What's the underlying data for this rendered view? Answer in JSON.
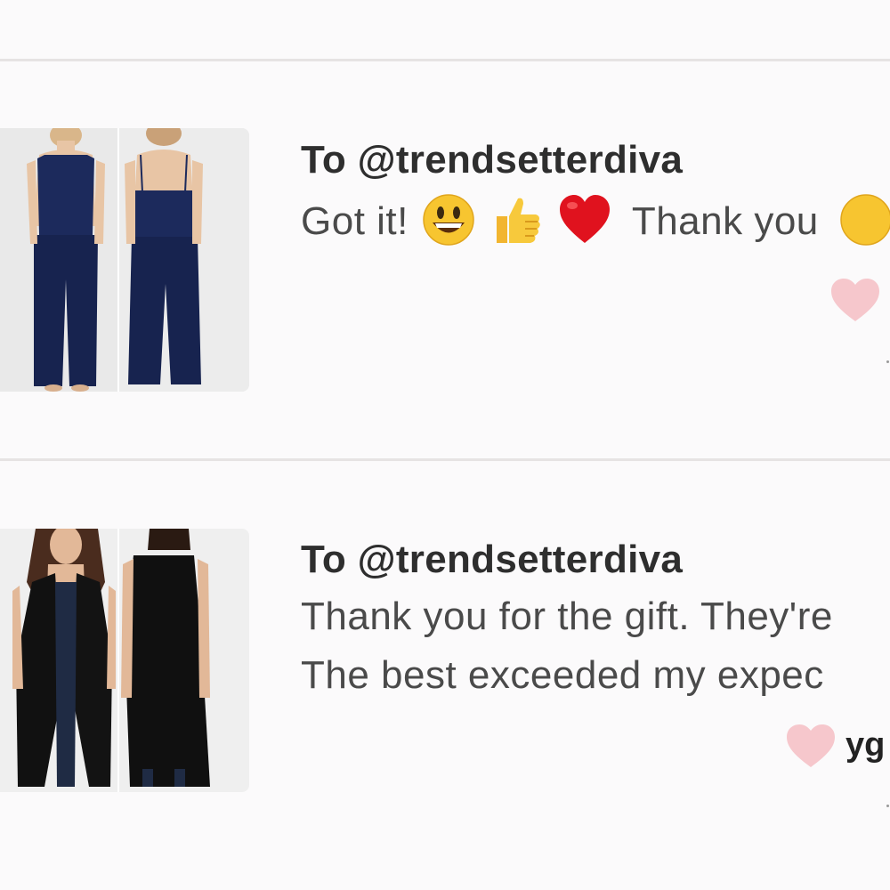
{
  "reviews": [
    {
      "recipient": "To @trendsetterdiva",
      "message_part1": "Got it!",
      "emojis": [
        "grinning-face-emoji",
        "thumbs-up-emoji",
        "red-heart-emoji"
      ],
      "message_part2": "Thank you",
      "trailing_emoji": "smiling-face-emoji",
      "product_image": "navy-jumpsuit-front-back",
      "like_icon": "heart-icon",
      "username": ""
    },
    {
      "recipient": "To @trendsetterdiva",
      "message_line1": "Thank you for the gift. They're",
      "message_line2": "The best exceeded my expec",
      "product_image": "black-vest-front-back",
      "like_icon": "heart-icon",
      "username": "yg"
    }
  ],
  "colors": {
    "background": "#fbfafb",
    "divider": "#e6e3e3",
    "heart": "#f6c7cc",
    "text": "#4a4a4a"
  }
}
